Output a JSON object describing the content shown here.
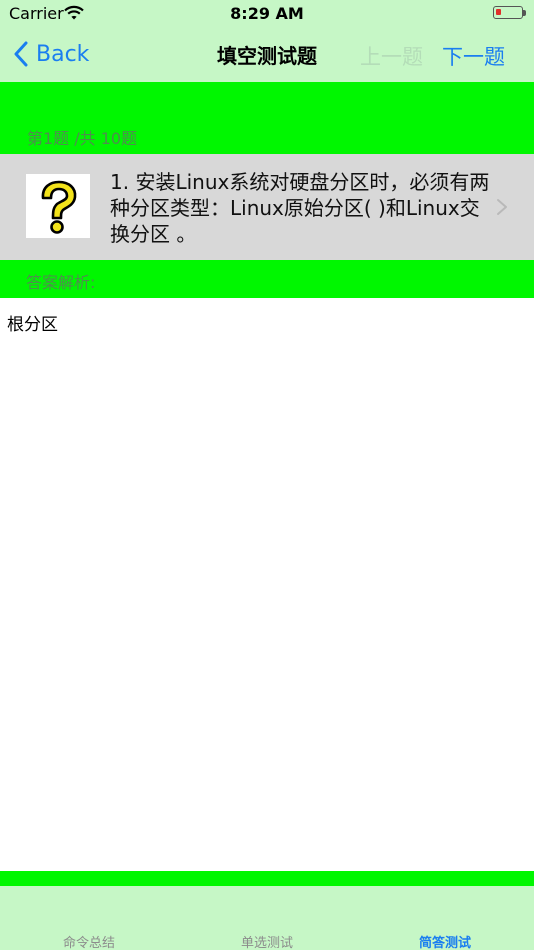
{
  "status": {
    "carrier": "Carrier",
    "time": "8:29 AM",
    "battery_level": 0.2,
    "battery_color": "#e0302a"
  },
  "nav": {
    "back_label": "Back",
    "title": "填空测试题",
    "prev_label": "上一题",
    "next_label": "下一题"
  },
  "progress": {
    "text": "第1题 /共 10题"
  },
  "question": {
    "icon": "question-mark-icon",
    "text": "1.  安装Linux系统对硬盘分区时，必须有两种分区类型：Linux原始分区( )和Linux交换分区   。"
  },
  "analysis": {
    "label": "答案解析:",
    "answer": "根分区"
  },
  "tabs": [
    {
      "label": "命令总结",
      "active": false
    },
    {
      "label": "单选测试",
      "active": false
    },
    {
      "label": "简答测试",
      "active": true
    }
  ],
  "colors": {
    "accent": "#1a7ef0",
    "bar_bg": "#c6f7c6",
    "band_green": "#00f700",
    "question_bg": "#d8d8d8"
  }
}
